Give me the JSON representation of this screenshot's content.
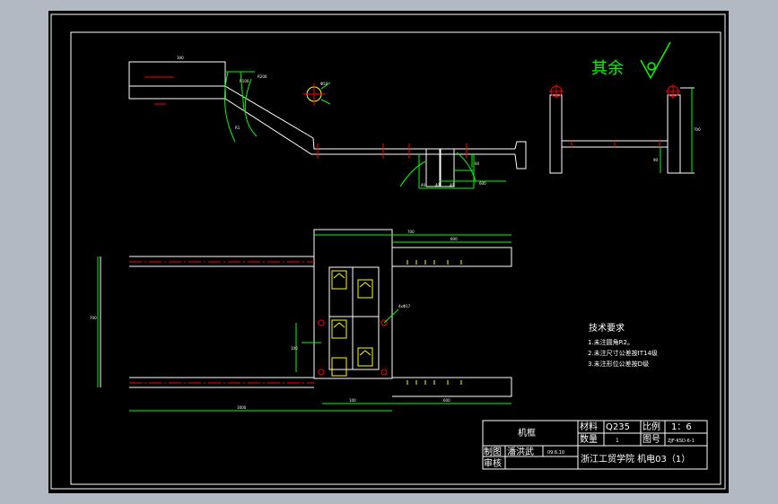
{
  "surface_note": {
    "text": "其余"
  },
  "tech_requirements": {
    "title": "技术要求",
    "items": [
      "1.未注圆角R2。",
      "2.未注尺寸公差按IT14级",
      "3.未注形位公差按D级"
    ]
  },
  "title_block": {
    "part_name": "机框",
    "material_label": "材料",
    "material_value": "Q235",
    "scale_label": "比例",
    "scale_value": "1：6",
    "quantity_label": "数量",
    "quantity_value": "1",
    "drawing_no_label": "图号",
    "drawing_no_value": "ZJF-KSD-6-1",
    "drawn_label": "制图",
    "drawn_name": "潘洪武",
    "date": "09.6.10",
    "review_label": "审核",
    "school": "浙江工贸学院  机电03（1）"
  },
  "colors": {
    "background": "#000000",
    "outline": "#ffffff",
    "dimension": "#00ff00",
    "centerline": "#ff0000",
    "desktop": "#b2b9c2"
  }
}
